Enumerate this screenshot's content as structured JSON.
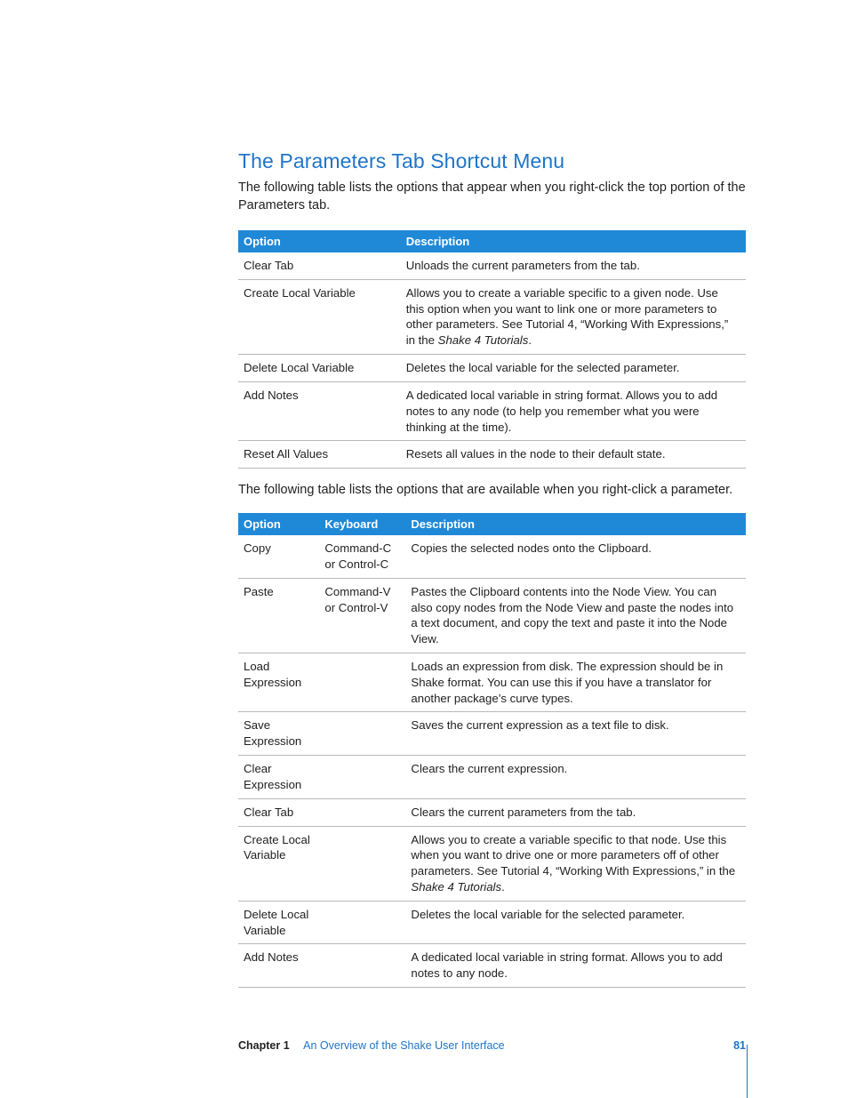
{
  "section": {
    "title": "The Parameters Tab Shortcut Menu",
    "intro": "The following table lists the options that appear when you right-click the top portion of the Parameters tab.",
    "mid": "The following table lists the options that are available when you right-click a parameter."
  },
  "table1": {
    "headers": {
      "c1": "Option",
      "c2": "Description"
    },
    "rows": [
      {
        "c1": "Clear Tab",
        "c2": "Unloads the current parameters from the tab."
      },
      {
        "c1": "Create Local Variable",
        "c2_pre": "Allows you to create a variable specific to a given node. Use this option when you want to link one or more parameters to other parameters. See Tutorial 4, “Working With Expressions,” in the ",
        "c2_ital": "Shake 4 Tutorials",
        "c2_post": "."
      },
      {
        "c1": "Delete Local Variable",
        "c2": "Deletes the local variable for the selected parameter."
      },
      {
        "c1": "Add Notes",
        "c2": "A dedicated local variable in string format. Allows you to add notes to any node (to help you remember what you were thinking at the time)."
      },
      {
        "c1": "Reset All Values",
        "c2": "Resets all values in the node to their default state."
      }
    ]
  },
  "table2": {
    "headers": {
      "c1": "Option",
      "c2": "Keyboard",
      "c3": "Description"
    },
    "rows": [
      {
        "c1": "Copy",
        "c2": "Command-C or Control-C",
        "c3": "Copies the selected nodes onto the Clipboard."
      },
      {
        "c1": "Paste",
        "c2": "Command-V or Control-V",
        "c3": "Pastes the Clipboard contents into the Node View. You can also copy nodes from the Node View and paste the nodes into a text document, and copy the text and paste it into the Node View."
      },
      {
        "c1": "Load Expression",
        "c2": "",
        "c3": "Loads an expression from disk. The expression should be in Shake format. You can use this if you have a translator for another package’s curve types."
      },
      {
        "c1": "Save Expression",
        "c2": "",
        "c3": "Saves the current expression as a text file to disk."
      },
      {
        "c1": "Clear Expression",
        "c2": "",
        "c3": "Clears the current expression."
      },
      {
        "c1": "Clear Tab",
        "c2": "",
        "c3": "Clears the current parameters from the tab."
      },
      {
        "c1": "Create Local Variable",
        "c2": "",
        "c3_pre": "Allows you to create a variable specific to that node. Use this when you want to drive one or more parameters off of other parameters. See Tutorial 4, “Working With Expressions,” in the ",
        "c3_ital": "Shake 4 Tutorials",
        "c3_post": "."
      },
      {
        "c1": "Delete Local Variable",
        "c2": "",
        "c3": "Deletes the local variable for the selected parameter."
      },
      {
        "c1": "Add Notes",
        "c2": "",
        "c3": "A dedicated local variable in string format. Allows you to add notes to any node."
      }
    ]
  },
  "footer": {
    "chapter_label": "Chapter 1",
    "chapter_title": "An Overview of the Shake User Interface",
    "page_number": "81"
  }
}
